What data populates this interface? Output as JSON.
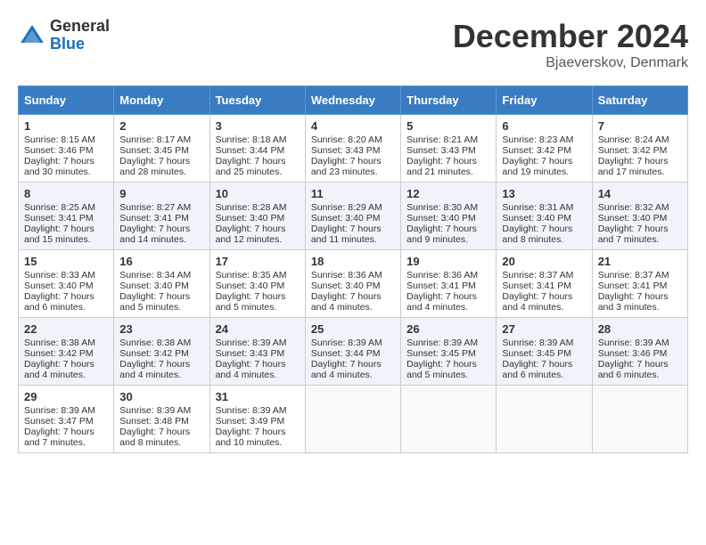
{
  "header": {
    "logo_general": "General",
    "logo_blue": "Blue",
    "month_title": "December 2024",
    "location": "Bjaeverskov, Denmark"
  },
  "days_of_week": [
    "Sunday",
    "Monday",
    "Tuesday",
    "Wednesday",
    "Thursday",
    "Friday",
    "Saturday"
  ],
  "weeks": [
    [
      {
        "day": 1,
        "sunrise": "Sunrise: 8:15 AM",
        "sunset": "Sunset: 3:46 PM",
        "daylight": "Daylight: 7 hours and 30 minutes."
      },
      {
        "day": 2,
        "sunrise": "Sunrise: 8:17 AM",
        "sunset": "Sunset: 3:45 PM",
        "daylight": "Daylight: 7 hours and 28 minutes."
      },
      {
        "day": 3,
        "sunrise": "Sunrise: 8:18 AM",
        "sunset": "Sunset: 3:44 PM",
        "daylight": "Daylight: 7 hours and 25 minutes."
      },
      {
        "day": 4,
        "sunrise": "Sunrise: 8:20 AM",
        "sunset": "Sunset: 3:43 PM",
        "daylight": "Daylight: 7 hours and 23 minutes."
      },
      {
        "day": 5,
        "sunrise": "Sunrise: 8:21 AM",
        "sunset": "Sunset: 3:43 PM",
        "daylight": "Daylight: 7 hours and 21 minutes."
      },
      {
        "day": 6,
        "sunrise": "Sunrise: 8:23 AM",
        "sunset": "Sunset: 3:42 PM",
        "daylight": "Daylight: 7 hours and 19 minutes."
      },
      {
        "day": 7,
        "sunrise": "Sunrise: 8:24 AM",
        "sunset": "Sunset: 3:42 PM",
        "daylight": "Daylight: 7 hours and 17 minutes."
      }
    ],
    [
      {
        "day": 8,
        "sunrise": "Sunrise: 8:25 AM",
        "sunset": "Sunset: 3:41 PM",
        "daylight": "Daylight: 7 hours and 15 minutes."
      },
      {
        "day": 9,
        "sunrise": "Sunrise: 8:27 AM",
        "sunset": "Sunset: 3:41 PM",
        "daylight": "Daylight: 7 hours and 14 minutes."
      },
      {
        "day": 10,
        "sunrise": "Sunrise: 8:28 AM",
        "sunset": "Sunset: 3:40 PM",
        "daylight": "Daylight: 7 hours and 12 minutes."
      },
      {
        "day": 11,
        "sunrise": "Sunrise: 8:29 AM",
        "sunset": "Sunset: 3:40 PM",
        "daylight": "Daylight: 7 hours and 11 minutes."
      },
      {
        "day": 12,
        "sunrise": "Sunrise: 8:30 AM",
        "sunset": "Sunset: 3:40 PM",
        "daylight": "Daylight: 7 hours and 9 minutes."
      },
      {
        "day": 13,
        "sunrise": "Sunrise: 8:31 AM",
        "sunset": "Sunset: 3:40 PM",
        "daylight": "Daylight: 7 hours and 8 minutes."
      },
      {
        "day": 14,
        "sunrise": "Sunrise: 8:32 AM",
        "sunset": "Sunset: 3:40 PM",
        "daylight": "Daylight: 7 hours and 7 minutes."
      }
    ],
    [
      {
        "day": 15,
        "sunrise": "Sunrise: 8:33 AM",
        "sunset": "Sunset: 3:40 PM",
        "daylight": "Daylight: 7 hours and 6 minutes."
      },
      {
        "day": 16,
        "sunrise": "Sunrise: 8:34 AM",
        "sunset": "Sunset: 3:40 PM",
        "daylight": "Daylight: 7 hours and 5 minutes."
      },
      {
        "day": 17,
        "sunrise": "Sunrise: 8:35 AM",
        "sunset": "Sunset: 3:40 PM",
        "daylight": "Daylight: 7 hours and 5 minutes."
      },
      {
        "day": 18,
        "sunrise": "Sunrise: 8:36 AM",
        "sunset": "Sunset: 3:40 PM",
        "daylight": "Daylight: 7 hours and 4 minutes."
      },
      {
        "day": 19,
        "sunrise": "Sunrise: 8:36 AM",
        "sunset": "Sunset: 3:41 PM",
        "daylight": "Daylight: 7 hours and 4 minutes."
      },
      {
        "day": 20,
        "sunrise": "Sunrise: 8:37 AM",
        "sunset": "Sunset: 3:41 PM",
        "daylight": "Daylight: 7 hours and 4 minutes."
      },
      {
        "day": 21,
        "sunrise": "Sunrise: 8:37 AM",
        "sunset": "Sunset: 3:41 PM",
        "daylight": "Daylight: 7 hours and 3 minutes."
      }
    ],
    [
      {
        "day": 22,
        "sunrise": "Sunrise: 8:38 AM",
        "sunset": "Sunset: 3:42 PM",
        "daylight": "Daylight: 7 hours and 4 minutes."
      },
      {
        "day": 23,
        "sunrise": "Sunrise: 8:38 AM",
        "sunset": "Sunset: 3:42 PM",
        "daylight": "Daylight: 7 hours and 4 minutes."
      },
      {
        "day": 24,
        "sunrise": "Sunrise: 8:39 AM",
        "sunset": "Sunset: 3:43 PM",
        "daylight": "Daylight: 7 hours and 4 minutes."
      },
      {
        "day": 25,
        "sunrise": "Sunrise: 8:39 AM",
        "sunset": "Sunset: 3:44 PM",
        "daylight": "Daylight: 7 hours and 4 minutes."
      },
      {
        "day": 26,
        "sunrise": "Sunrise: 8:39 AM",
        "sunset": "Sunset: 3:45 PM",
        "daylight": "Daylight: 7 hours and 5 minutes."
      },
      {
        "day": 27,
        "sunrise": "Sunrise: 8:39 AM",
        "sunset": "Sunset: 3:45 PM",
        "daylight": "Daylight: 7 hours and 6 minutes."
      },
      {
        "day": 28,
        "sunrise": "Sunrise: 8:39 AM",
        "sunset": "Sunset: 3:46 PM",
        "daylight": "Daylight: 7 hours and 6 minutes."
      }
    ],
    [
      {
        "day": 29,
        "sunrise": "Sunrise: 8:39 AM",
        "sunset": "Sunset: 3:47 PM",
        "daylight": "Daylight: 7 hours and 7 minutes."
      },
      {
        "day": 30,
        "sunrise": "Sunrise: 8:39 AM",
        "sunset": "Sunset: 3:48 PM",
        "daylight": "Daylight: 7 hours and 8 minutes."
      },
      {
        "day": 31,
        "sunrise": "Sunrise: 8:39 AM",
        "sunset": "Sunset: 3:49 PM",
        "daylight": "Daylight: 7 hours and 10 minutes."
      },
      null,
      null,
      null,
      null
    ]
  ]
}
